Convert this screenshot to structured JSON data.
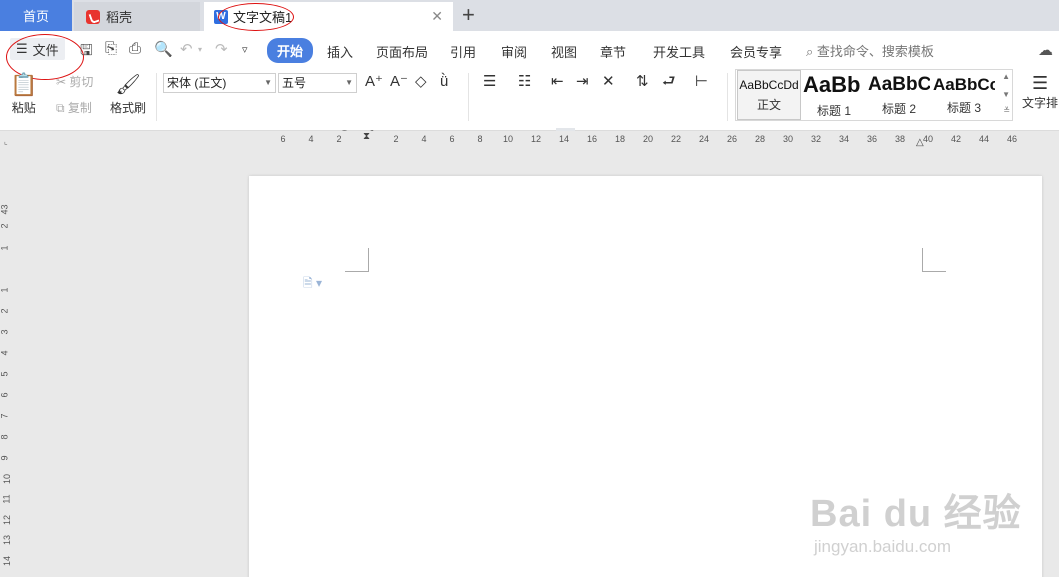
{
  "tabs": {
    "home": "首页",
    "daoke": "稻壳",
    "doc": "文字文稿1"
  },
  "menu": {
    "file": "文件",
    "items": [
      "开始",
      "插入",
      "页面布局",
      "引用",
      "审阅",
      "视图",
      "章节",
      "开发工具",
      "会员专享"
    ],
    "search": "查找命令、搜索模板"
  },
  "clipboard": {
    "paste": "粘贴",
    "cut": "剪切",
    "copy": "复制",
    "format_painter": "格式刷"
  },
  "font": {
    "family": "宋体 (正文)",
    "size": "五号"
  },
  "styles": [
    {
      "preview": "AaBbCcDd",
      "name": "正文"
    },
    {
      "preview": "AaBb",
      "name": "标题 1"
    },
    {
      "preview": "AaBbC",
      "name": "标题 2"
    },
    {
      "preview": "AaBbCc",
      "name": "标题 3"
    }
  ],
  "text_tools_label": "文字排",
  "ruler": {
    "h_ticks": [
      "6",
      "4",
      "2",
      "2",
      "4",
      "6",
      "8",
      "10",
      "12",
      "14",
      "16",
      "18",
      "20",
      "22",
      "24",
      "26",
      "28",
      "30",
      "32",
      "34",
      "36",
      "38",
      "40",
      "42",
      "44",
      "46"
    ],
    "v_ticks": [
      "4",
      "3",
      "2",
      "1",
      "1",
      "2",
      "3",
      "4",
      "5",
      "6",
      "7",
      "8",
      "9",
      "10",
      "11",
      "12",
      "13",
      "14"
    ]
  },
  "watermark": {
    "logo": "Bai du 经验",
    "url": "jingyan.baidu.com"
  },
  "colors": {
    "accent": "#4a7fe0",
    "highlight": "#f2e400",
    "font_color": "#1a3ad6"
  }
}
